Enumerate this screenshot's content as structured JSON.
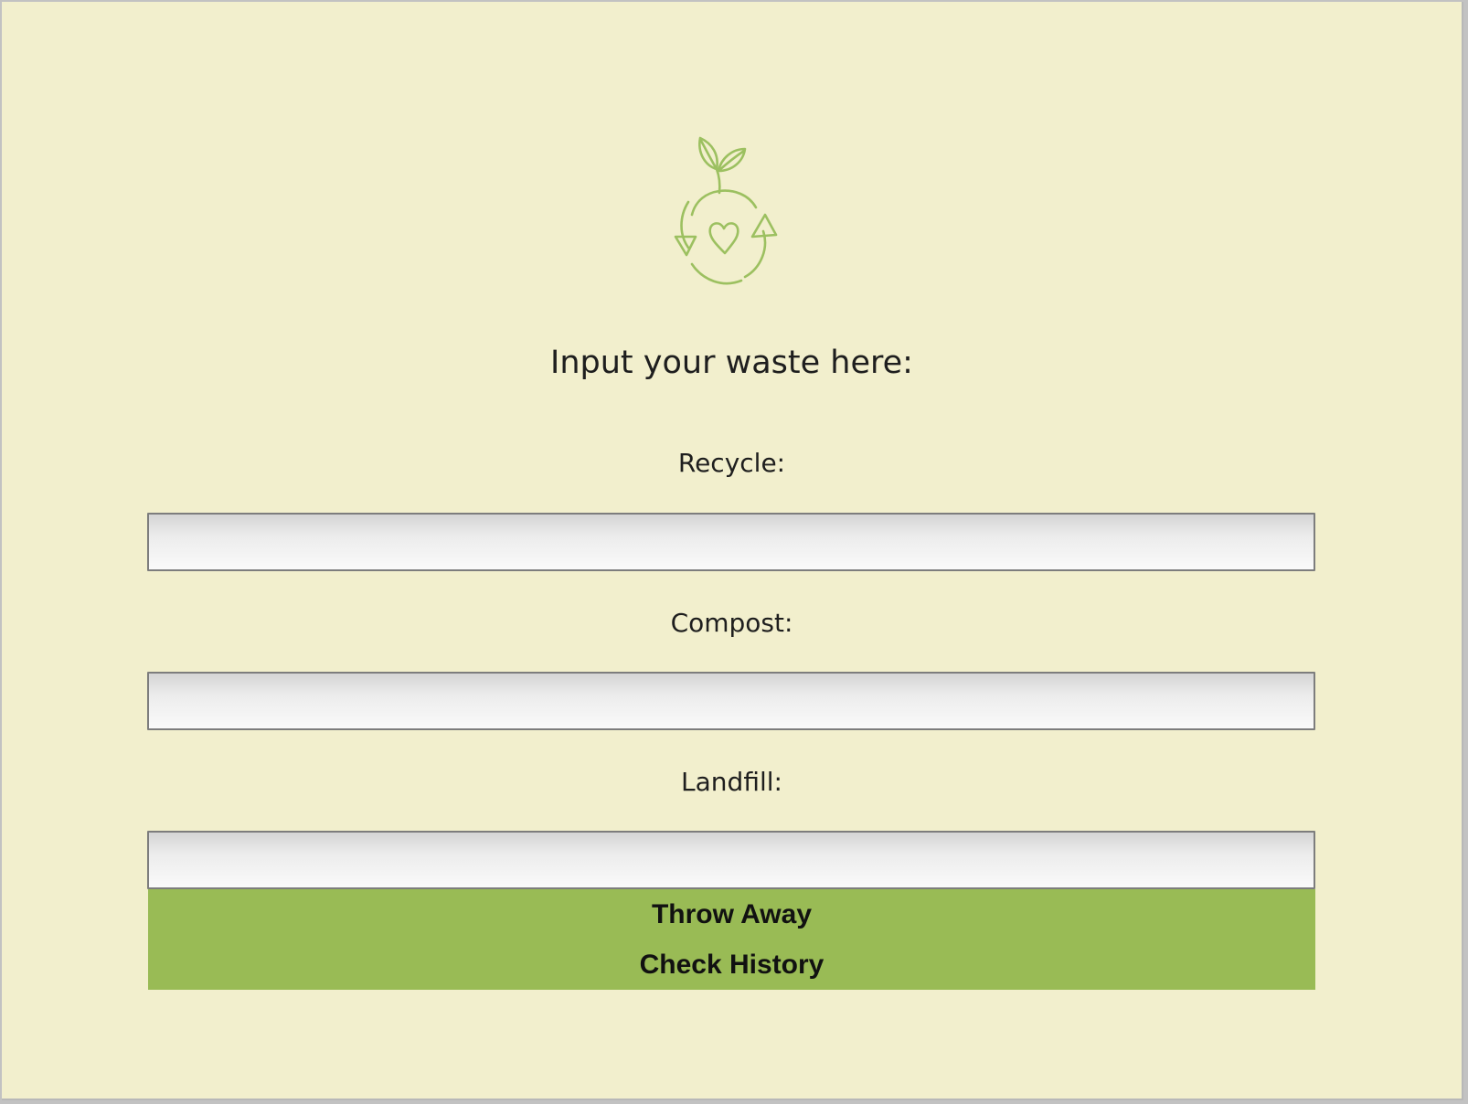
{
  "app": {
    "logo_icon": "recycle-heart-sprout-icon",
    "accent_color": "#99bb55",
    "background_color": "#f2efcd"
  },
  "form": {
    "heading": "Input your waste here:",
    "fields": [
      {
        "label": "Recycle:",
        "value": ""
      },
      {
        "label": "Compost:",
        "value": ""
      },
      {
        "label": "Landfill:",
        "value": ""
      }
    ]
  },
  "buttons": {
    "throw_away": "Throw Away",
    "check_history": "Check History"
  }
}
